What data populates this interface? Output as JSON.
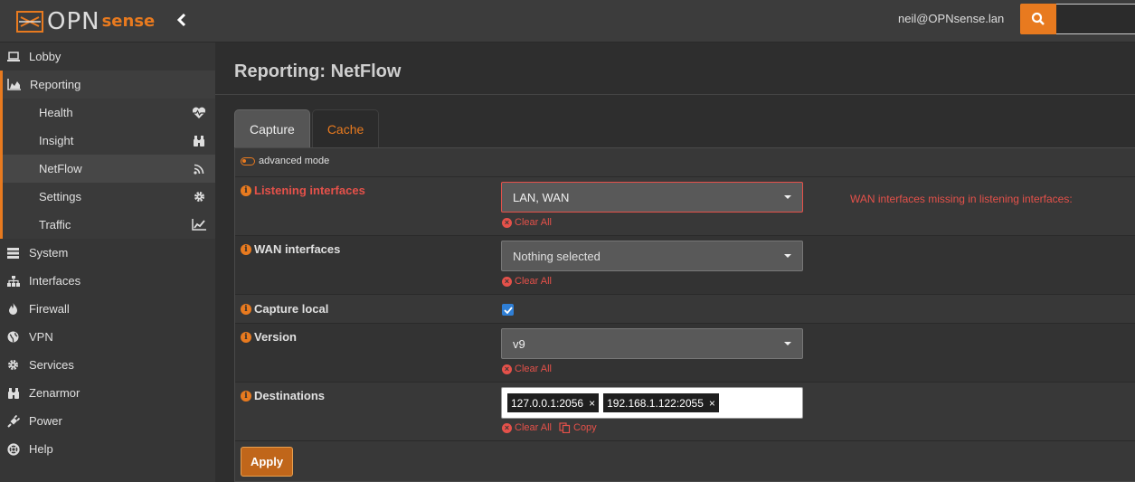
{
  "header": {
    "logo_text": "OPN",
    "logo_text_accent": "sense",
    "user_email": "neil@OPNsense.lan",
    "search_placeholder": ""
  },
  "sidebar": {
    "items": [
      {
        "label": "Lobby",
        "icon": "laptop-icon"
      },
      {
        "label": "Reporting",
        "icon": "area-chart-icon",
        "expanded": true,
        "children": [
          {
            "label": "Health",
            "icon": "heartbeat-icon"
          },
          {
            "label": "Insight",
            "icon": "binoculars-icon"
          },
          {
            "label": "NetFlow",
            "icon": "rss-icon",
            "active": true
          },
          {
            "label": "Settings",
            "icon": "gear-icon"
          },
          {
            "label": "Traffic",
            "icon": "line-chart-icon"
          }
        ]
      },
      {
        "label": "System",
        "icon": "server-icon"
      },
      {
        "label": "Interfaces",
        "icon": "sitemap-icon"
      },
      {
        "label": "Firewall",
        "icon": "fire-icon"
      },
      {
        "label": "VPN",
        "icon": "globe-icon"
      },
      {
        "label": "Services",
        "icon": "cog-icon"
      },
      {
        "label": "Zenarmor",
        "icon": "binoculars-icon"
      },
      {
        "label": "Power",
        "icon": "plug-icon"
      },
      {
        "label": "Help",
        "icon": "lifebuoy-icon"
      }
    ]
  },
  "main": {
    "title": "Reporting: NetFlow",
    "tabs": [
      {
        "label": "Capture",
        "active": true
      },
      {
        "label": "Cache",
        "active": false
      }
    ],
    "advanced_mode_label": "advanced mode",
    "fields": {
      "listening_interfaces": {
        "label": "Listening interfaces",
        "value": "LAN, WAN",
        "clear_label": "Clear All",
        "warning": "WAN interfaces missing in listening interfaces:"
      },
      "wan_interfaces": {
        "label": "WAN interfaces",
        "value": "Nothing selected",
        "clear_label": "Clear All"
      },
      "capture_local": {
        "label": "Capture local",
        "checked": true
      },
      "version": {
        "label": "Version",
        "value": "v9",
        "clear_label": "Clear All"
      },
      "destinations": {
        "label": "Destinations",
        "tags": [
          "127.0.0.1:2056",
          "192.168.1.122:2055"
        ],
        "clear_label": "Clear All",
        "copy_label": "Copy"
      }
    },
    "apply_label": "Apply"
  },
  "colors": {
    "accent": "#e87a1f",
    "error": "#e5514a",
    "checkbox": "#2f7fd6"
  }
}
